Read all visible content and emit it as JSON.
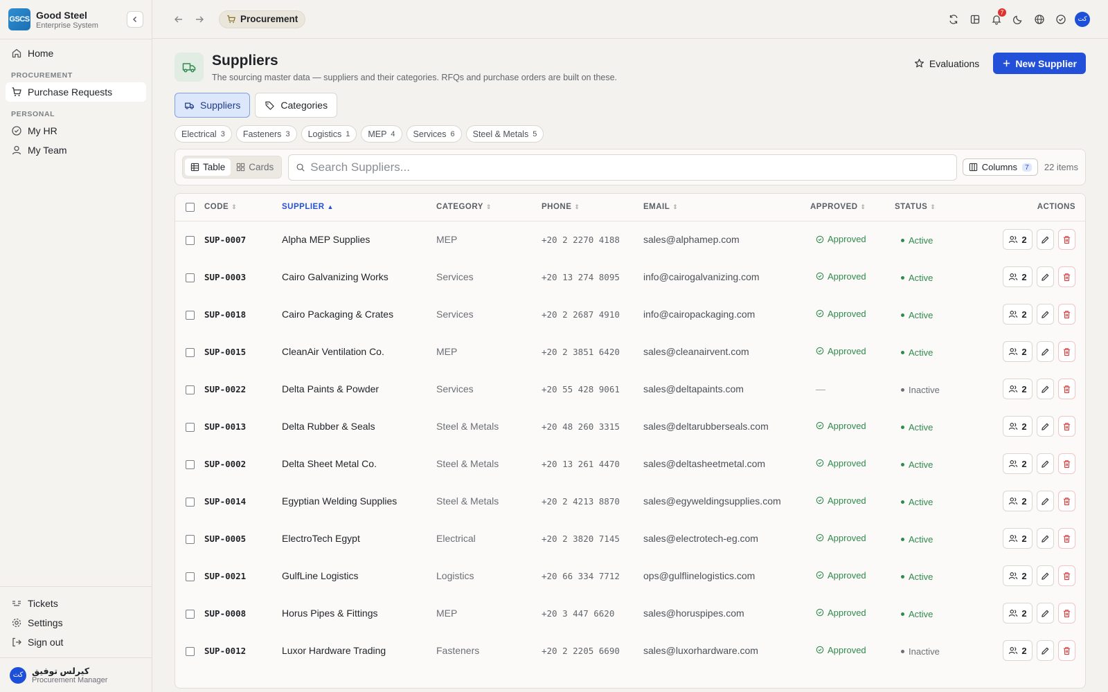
{
  "brand": {
    "logo": "GSCS",
    "name": "Good Steel",
    "sub": "Enterprise System"
  },
  "sidebar": {
    "home": "Home",
    "procurement_section": "PROCUREMENT",
    "purchase_requests": "Purchase Requests",
    "personal_section": "PERSONAL",
    "my_hr": "My HR",
    "my_team": "My Team",
    "tickets": "Tickets",
    "settings": "Settings",
    "sign_out": "Sign out"
  },
  "user": {
    "initials": "كت",
    "name": "كيرلس توفيق",
    "role": "Procurement Manager"
  },
  "topbar": {
    "breadcrumb": "Procurement",
    "notifications": "7",
    "avatar": "كت"
  },
  "page": {
    "title": "Suppliers",
    "description": "The sourcing master data — suppliers and their categories. RFQs and purchase orders are built on these.",
    "evaluations": "Evaluations",
    "new_supplier": "New Supplier"
  },
  "tabs": {
    "suppliers": "Suppliers",
    "categories": "Categories"
  },
  "chips": [
    {
      "label": "Electrical",
      "count": "3"
    },
    {
      "label": "Fasteners",
      "count": "3"
    },
    {
      "label": "Logistics",
      "count": "1"
    },
    {
      "label": "MEP",
      "count": "4"
    },
    {
      "label": "Services",
      "count": "6"
    },
    {
      "label": "Steel & Metals",
      "count": "5"
    }
  ],
  "toolbar": {
    "table": "Table",
    "cards": "Cards",
    "search_placeholder": "Search Suppliers...",
    "columns": "Columns",
    "columns_count": "7",
    "items": "22 items"
  },
  "table": {
    "headers": {
      "code": "CODE",
      "supplier": "SUPPLIER",
      "category": "CATEGORY",
      "phone": "PHONE",
      "email": "EMAIL",
      "approved": "APPROVED",
      "status": "STATUS",
      "actions": "ACTIONS"
    },
    "rows": [
      {
        "code": "SUP-0007",
        "supplier": "Alpha MEP Supplies",
        "category": "MEP",
        "phone": "+20 2 2270 4188",
        "email": "sales@alphamep.com",
        "approved": "Approved",
        "status": "Active",
        "contacts": "2"
      },
      {
        "code": "SUP-0003",
        "supplier": "Cairo Galvanizing Works",
        "category": "Services",
        "phone": "+20 13 274 8095",
        "email": "info@cairogalvanizing.com",
        "approved": "Approved",
        "status": "Active",
        "contacts": "2"
      },
      {
        "code": "SUP-0018",
        "supplier": "Cairo Packaging & Crates",
        "category": "Services",
        "phone": "+20 2 2687 4910",
        "email": "info@cairopackaging.com",
        "approved": "Approved",
        "status": "Active",
        "contacts": "2"
      },
      {
        "code": "SUP-0015",
        "supplier": "CleanAir Ventilation Co.",
        "category": "MEP",
        "phone": "+20 2 3851 6420",
        "email": "sales@cleanairvent.com",
        "approved": "Approved",
        "status": "Active",
        "contacts": "2"
      },
      {
        "code": "SUP-0022",
        "supplier": "Delta Paints & Powder",
        "category": "Services",
        "phone": "+20 55 428 9061",
        "email": "sales@deltapaints.com",
        "approved": "—",
        "status": "Inactive",
        "contacts": "2"
      },
      {
        "code": "SUP-0013",
        "supplier": "Delta Rubber & Seals",
        "category": "Steel & Metals",
        "phone": "+20 48 260 3315",
        "email": "sales@deltarubberseals.com",
        "approved": "Approved",
        "status": "Active",
        "contacts": "2"
      },
      {
        "code": "SUP-0002",
        "supplier": "Delta Sheet Metal Co.",
        "category": "Steel & Metals",
        "phone": "+20 13 261 4470",
        "email": "sales@deltasheetmetal.com",
        "approved": "Approved",
        "status": "Active",
        "contacts": "2"
      },
      {
        "code": "SUP-0014",
        "supplier": "Egyptian Welding Supplies",
        "category": "Steel & Metals",
        "phone": "+20 2 4213 8870",
        "email": "sales@egyweldingsupplies.com",
        "approved": "Approved",
        "status": "Active",
        "contacts": "2"
      },
      {
        "code": "SUP-0005",
        "supplier": "ElectroTech Egypt",
        "category": "Electrical",
        "phone": "+20 2 3820 7145",
        "email": "sales@electrotech-eg.com",
        "approved": "Approved",
        "status": "Active",
        "contacts": "2"
      },
      {
        "code": "SUP-0021",
        "supplier": "GulfLine Logistics",
        "category": "Logistics",
        "phone": "+20 66 334 7712",
        "email": "ops@gulflinelogistics.com",
        "approved": "Approved",
        "status": "Active",
        "contacts": "2"
      },
      {
        "code": "SUP-0008",
        "supplier": "Horus Pipes & Fittings",
        "category": "MEP",
        "phone": "+20 3 447 6620",
        "email": "sales@horuspipes.com",
        "approved": "Approved",
        "status": "Active",
        "contacts": "2"
      },
      {
        "code": "SUP-0012",
        "supplier": "Luxor Hardware Trading",
        "category": "Fasteners",
        "phone": "+20 2 2205 6690",
        "email": "sales@luxorhardware.com",
        "approved": "Approved",
        "status": "Inactive",
        "contacts": "2"
      }
    ]
  }
}
